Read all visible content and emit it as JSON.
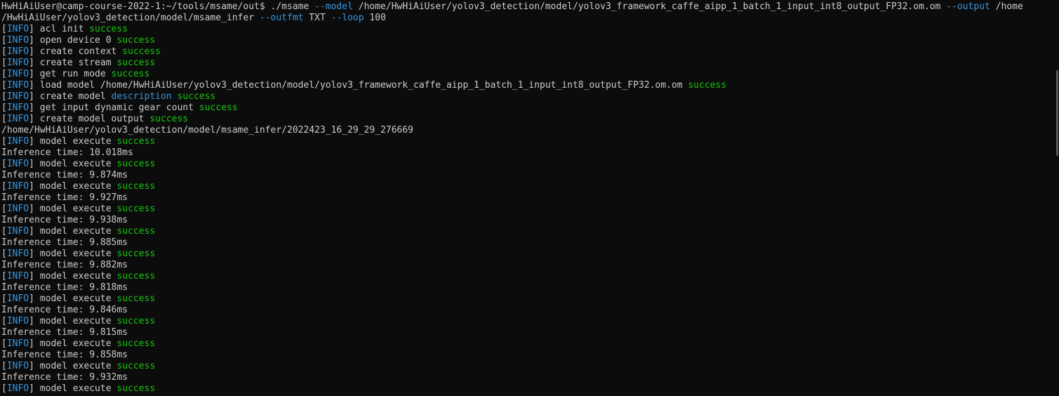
{
  "theme": {
    "background": "#0c0c0c",
    "text": "#cccccc",
    "info": "#3a96dd",
    "success": "#16c60c",
    "option": "#3a96dd"
  },
  "terminal": {
    "lines": [
      [
        {
          "t": "HwHiAiUser@camp-course-2022-1:~/tools/msame/out$ ./msame ",
          "s": "plain"
        },
        {
          "t": "--model",
          "s": "option"
        },
        {
          "t": " /home/HwHiAiUser/yolov3_detection/model/yolov3_framework_caffe_aipp_1_batch_1_input_int8_output_FP32.om.om ",
          "s": "plain"
        },
        {
          "t": "--output",
          "s": "option"
        },
        {
          "t": " /home",
          "s": "plain"
        }
      ],
      [
        {
          "t": "/HwHiAiUser/yolov3_detection/model/msame_infer ",
          "s": "plain"
        },
        {
          "t": "--outfmt",
          "s": "option"
        },
        {
          "t": " TXT ",
          "s": "plain"
        },
        {
          "t": "--loop",
          "s": "option"
        },
        {
          "t": " 100",
          "s": "plain"
        }
      ],
      [
        {
          "t": "[",
          "s": "plain"
        },
        {
          "t": "INFO",
          "s": "info"
        },
        {
          "t": "] acl init ",
          "s": "plain"
        },
        {
          "t": "success",
          "s": "success"
        }
      ],
      [
        {
          "t": "[",
          "s": "plain"
        },
        {
          "t": "INFO",
          "s": "info"
        },
        {
          "t": "] open device 0 ",
          "s": "plain"
        },
        {
          "t": "success",
          "s": "success"
        }
      ],
      [
        {
          "t": "[",
          "s": "plain"
        },
        {
          "t": "INFO",
          "s": "info"
        },
        {
          "t": "] create context ",
          "s": "plain"
        },
        {
          "t": "success",
          "s": "success"
        }
      ],
      [
        {
          "t": "[",
          "s": "plain"
        },
        {
          "t": "INFO",
          "s": "info"
        },
        {
          "t": "] create stream ",
          "s": "plain"
        },
        {
          "t": "success",
          "s": "success"
        }
      ],
      [
        {
          "t": "[",
          "s": "plain"
        },
        {
          "t": "INFO",
          "s": "info"
        },
        {
          "t": "] get run mode ",
          "s": "plain"
        },
        {
          "t": "success",
          "s": "success"
        }
      ],
      [
        {
          "t": "[",
          "s": "plain"
        },
        {
          "t": "INFO",
          "s": "info"
        },
        {
          "t": "] load model /home/HwHiAiUser/yolov3_detection/model/yolov3_framework_caffe_aipp_1_batch_1_input_int8_output_FP32.om.om ",
          "s": "plain"
        },
        {
          "t": "success",
          "s": "success"
        }
      ],
      [
        {
          "t": "[",
          "s": "plain"
        },
        {
          "t": "INFO",
          "s": "info"
        },
        {
          "t": "] create model ",
          "s": "plain"
        },
        {
          "t": "description",
          "s": "info"
        },
        {
          "t": " ",
          "s": "plain"
        },
        {
          "t": "success",
          "s": "success"
        }
      ],
      [
        {
          "t": "[",
          "s": "plain"
        },
        {
          "t": "INFO",
          "s": "info"
        },
        {
          "t": "] get input dynamic gear count ",
          "s": "plain"
        },
        {
          "t": "success",
          "s": "success"
        }
      ],
      [
        {
          "t": "[",
          "s": "plain"
        },
        {
          "t": "INFO",
          "s": "info"
        },
        {
          "t": "] create model output ",
          "s": "plain"
        },
        {
          "t": "success",
          "s": "success"
        }
      ],
      [
        {
          "t": "/home/HwHiAiUser/yolov3_detection/model/msame_infer/2022423_16_29_29_276669",
          "s": "plain"
        }
      ],
      [
        {
          "t": "[",
          "s": "plain"
        },
        {
          "t": "INFO",
          "s": "info"
        },
        {
          "t": "] model execute ",
          "s": "plain"
        },
        {
          "t": "success",
          "s": "success"
        }
      ],
      [
        {
          "t": "Inference time: 10.018ms",
          "s": "plain"
        }
      ],
      [
        {
          "t": "[",
          "s": "plain"
        },
        {
          "t": "INFO",
          "s": "info"
        },
        {
          "t": "] model execute ",
          "s": "plain"
        },
        {
          "t": "success",
          "s": "success"
        }
      ],
      [
        {
          "t": "Inference time: 9.874ms",
          "s": "plain"
        }
      ],
      [
        {
          "t": "[",
          "s": "plain"
        },
        {
          "t": "INFO",
          "s": "info"
        },
        {
          "t": "] model execute ",
          "s": "plain"
        },
        {
          "t": "success",
          "s": "success"
        }
      ],
      [
        {
          "t": "Inference time: 9.927ms",
          "s": "plain"
        }
      ],
      [
        {
          "t": "[",
          "s": "plain"
        },
        {
          "t": "INFO",
          "s": "info"
        },
        {
          "t": "] model execute ",
          "s": "plain"
        },
        {
          "t": "success",
          "s": "success"
        }
      ],
      [
        {
          "t": "Inference time: 9.938ms",
          "s": "plain"
        }
      ],
      [
        {
          "t": "[",
          "s": "plain"
        },
        {
          "t": "INFO",
          "s": "info"
        },
        {
          "t": "] model execute ",
          "s": "plain"
        },
        {
          "t": "success",
          "s": "success"
        }
      ],
      [
        {
          "t": "Inference time: 9.885ms",
          "s": "plain"
        }
      ],
      [
        {
          "t": "[",
          "s": "plain"
        },
        {
          "t": "INFO",
          "s": "info"
        },
        {
          "t": "] model execute ",
          "s": "plain"
        },
        {
          "t": "success",
          "s": "success"
        }
      ],
      [
        {
          "t": "Inference time: 9.882ms",
          "s": "plain"
        }
      ],
      [
        {
          "t": "[",
          "s": "plain"
        },
        {
          "t": "INFO",
          "s": "info"
        },
        {
          "t": "] model execute ",
          "s": "plain"
        },
        {
          "t": "success",
          "s": "success"
        }
      ],
      [
        {
          "t": "Inference time: 9.818ms",
          "s": "plain"
        }
      ],
      [
        {
          "t": "[",
          "s": "plain"
        },
        {
          "t": "INFO",
          "s": "info"
        },
        {
          "t": "] model execute ",
          "s": "plain"
        },
        {
          "t": "success",
          "s": "success"
        }
      ],
      [
        {
          "t": "Inference time: 9.846ms",
          "s": "plain"
        }
      ],
      [
        {
          "t": "[",
          "s": "plain"
        },
        {
          "t": "INFO",
          "s": "info"
        },
        {
          "t": "] model execute ",
          "s": "plain"
        },
        {
          "t": "success",
          "s": "success"
        }
      ],
      [
        {
          "t": "Inference time: 9.815ms",
          "s": "plain"
        }
      ],
      [
        {
          "t": "[",
          "s": "plain"
        },
        {
          "t": "INFO",
          "s": "info"
        },
        {
          "t": "] model execute ",
          "s": "plain"
        },
        {
          "t": "success",
          "s": "success"
        }
      ],
      [
        {
          "t": "Inference time: 9.858ms",
          "s": "plain"
        }
      ],
      [
        {
          "t": "[",
          "s": "plain"
        },
        {
          "t": "INFO",
          "s": "info"
        },
        {
          "t": "] model execute ",
          "s": "plain"
        },
        {
          "t": "success",
          "s": "success"
        }
      ],
      [
        {
          "t": "Inference time: 9.932ms",
          "s": "plain"
        }
      ],
      [
        {
          "t": "[",
          "s": "plain"
        },
        {
          "t": "INFO",
          "s": "info"
        },
        {
          "t": "] model execute ",
          "s": "plain"
        },
        {
          "t": "success",
          "s": "success"
        }
      ]
    ]
  }
}
